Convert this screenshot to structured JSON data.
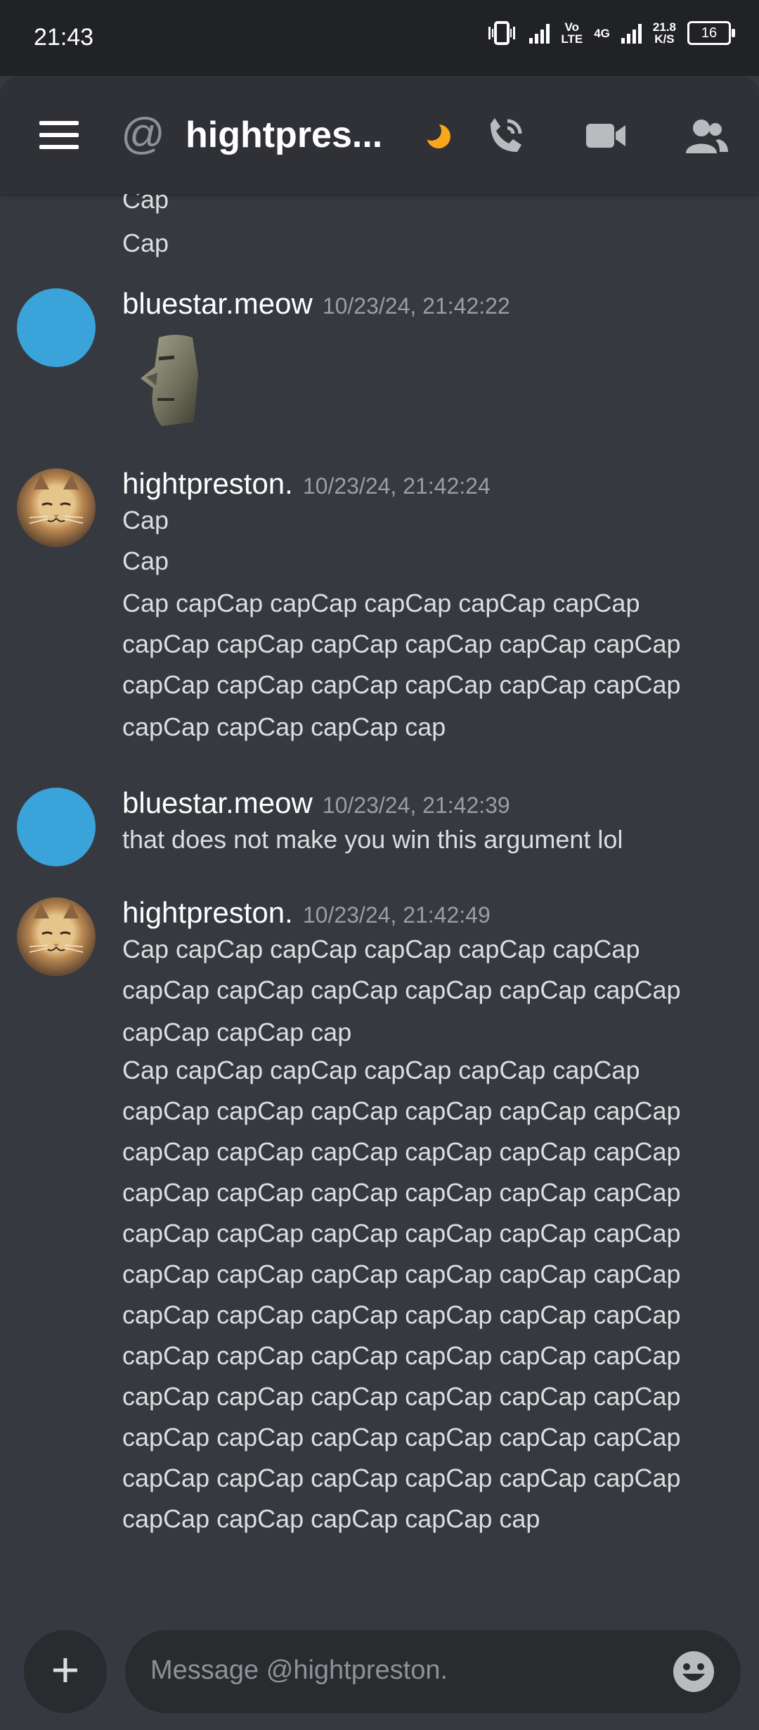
{
  "status_bar": {
    "time": "21:43",
    "volte_top": "Vo",
    "volte_bottom": "LTE",
    "network": "4G",
    "speed_value": "21.8",
    "speed_unit": "K/S",
    "battery": "16"
  },
  "header": {
    "prefix": "@",
    "title": "hightpres..."
  },
  "messages": [
    {
      "lines": [
        "Cap",
        "Cap"
      ]
    },
    {
      "username": "bluestar.meow",
      "timestamp": "10/23/24, 21:42:22"
    },
    {
      "username": "hightpreston.",
      "timestamp": "10/23/24, 21:42:24",
      "lines": [
        "Cap",
        "Cap",
        "Cap capCap capCap capCap capCap capCap",
        "capCap capCap capCap capCap capCap capCap",
        "capCap capCap capCap capCap capCap capCap",
        "capCap capCap capCap cap"
      ]
    },
    {
      "username": "bluestar.meow",
      "timestamp": "10/23/24, 21:42:39",
      "lines": [
        "that does not make you win this argument lol"
      ]
    },
    {
      "username": "hightpreston.",
      "timestamp": "10/23/24, 21:42:49",
      "lines": [
        "Cap capCap capCap capCap capCap capCap",
        "capCap capCap capCap capCap capCap capCap",
        "capCap capCap cap",
        "Cap capCap capCap capCap capCap capCap",
        "capCap capCap capCap capCap capCap capCap",
        "capCap capCap capCap capCap capCap capCap",
        "capCap capCap capCap capCap capCap capCap",
        "capCap capCap capCap capCap capCap capCap",
        "capCap capCap capCap capCap capCap capCap",
        "capCap capCap capCap capCap capCap capCap",
        "capCap capCap capCap capCap capCap capCap",
        "capCap capCap capCap capCap capCap capCap",
        "capCap capCap capCap capCap capCap capCap",
        "capCap capCap capCap capCap capCap capCap",
        "capCap capCap capCap capCap cap"
      ]
    }
  ],
  "composer": {
    "plus": "+",
    "placeholder": "Message @hightpreston."
  }
}
